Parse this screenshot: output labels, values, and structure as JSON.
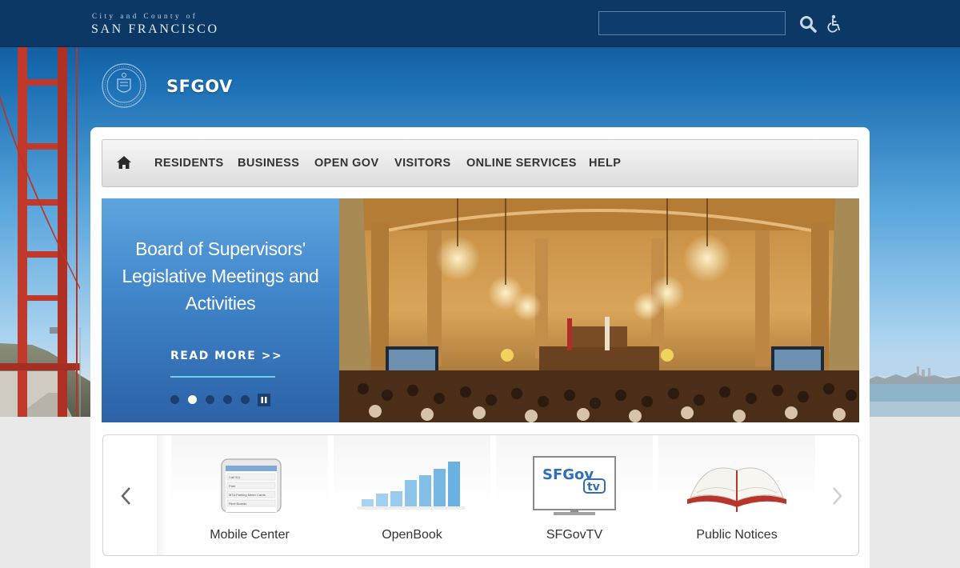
{
  "header": {
    "city_line1": "City and County of",
    "city_line2": "SAN FRANCISCO",
    "site_title": "SFGOV",
    "search_value": "",
    "icons": [
      "search-icon",
      "accessibility-icon",
      "city-seal"
    ]
  },
  "nav": {
    "home_icon": "home-icon",
    "items": [
      {
        "label": "RESIDENTS"
      },
      {
        "label": "BUSINESS"
      },
      {
        "label": "OPEN GOV"
      },
      {
        "label": "VISITORS"
      },
      {
        "label": "ONLINE SERVICES"
      },
      {
        "label": "HELP"
      }
    ]
  },
  "hero": {
    "title": "Board of Supervisors' Legislative Meetings and Activities",
    "read_more": "READ MORE >>",
    "slide_count": 5,
    "active_slide": 2,
    "pause_icon": "pause-icon"
  },
  "carousel": {
    "cards": [
      {
        "label": "Mobile Center",
        "icon": "mobile-phone-icon"
      },
      {
        "label": "OpenBook",
        "icon": "bar-chart-icon"
      },
      {
        "label": "SFGovTV",
        "icon": "tv-icon",
        "tv_logo": "SFGov",
        "tv_logo_sub": "tv"
      },
      {
        "label": "Public Notices",
        "icon": "open-book-icon"
      }
    ],
    "phone_rows": [
      "Call 311",
      "Park",
      "MTA Parking Meter Cards",
      "Rent Boards"
    ]
  },
  "colors": {
    "topbar": "#0c3866",
    "nav_text": "#333333",
    "hero_panel": "#3f84c9",
    "accent_line": "#6fd0f0",
    "bar_color": "#7fc1ea"
  }
}
